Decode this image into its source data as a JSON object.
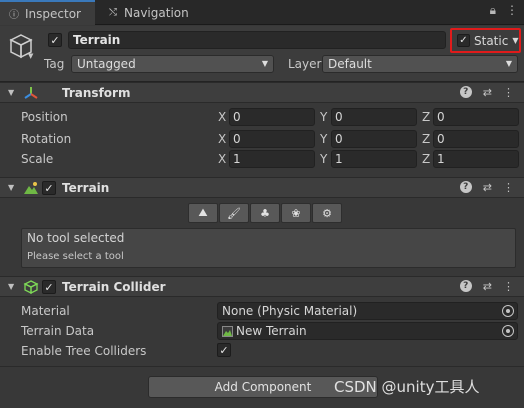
{
  "tabs": {
    "inspector": "Inspector",
    "navigation": "Navigation"
  },
  "object": {
    "name": "Terrain",
    "static_label": "Static",
    "tag_label": "Tag",
    "tag_value": "Untagged",
    "layer_label": "Layer",
    "layer_value": "Default"
  },
  "transform": {
    "title": "Transform",
    "rows": [
      {
        "label": "Position",
        "x": "0",
        "y": "0",
        "z": "0"
      },
      {
        "label": "Rotation",
        "x": "0",
        "y": "0",
        "z": "0"
      },
      {
        "label": "Scale",
        "x": "1",
        "y": "1",
        "z": "1"
      }
    ],
    "axes": {
      "x": "X",
      "y": "Y",
      "z": "Z"
    }
  },
  "terrain": {
    "title": "Terrain",
    "tools": [
      "raise-terrain-icon",
      "paint-brush-icon",
      "tree-icon",
      "details-icon",
      "settings-gear-icon"
    ],
    "help_main": "No tool selected",
    "help_sub": "Please select a tool"
  },
  "collider": {
    "title": "Terrain Collider",
    "material_label": "Material",
    "material_value": "None (Physic Material)",
    "data_label": "Terrain Data",
    "data_value": "New Terrain",
    "tree_label": "Enable Tree Colliders"
  },
  "add_component": "Add Component",
  "watermark": "CSDN @unity工具人",
  "colors": {
    "highlight": "#e01b1b",
    "tab_accent": "#3a79bb",
    "background": "#383838"
  }
}
